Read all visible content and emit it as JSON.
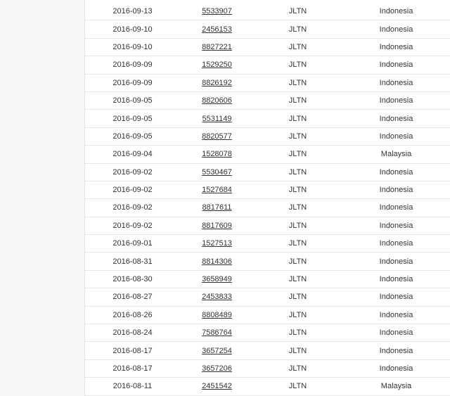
{
  "table": {
    "rows": [
      {
        "date": "2016-09-13",
        "id": "5533907",
        "code": "JLTN",
        "country": "Indonesia"
      },
      {
        "date": "2016-09-10",
        "id": "2456153",
        "code": "JLTN",
        "country": "Indonesia"
      },
      {
        "date": "2016-09-10",
        "id": "8827221",
        "code": "JLTN",
        "country": "Indonesia"
      },
      {
        "date": "2016-09-09",
        "id": "1529250",
        "code": "JLTN",
        "country": "Indonesia"
      },
      {
        "date": "2016-09-09",
        "id": "8826192",
        "code": "JLTN",
        "country": "Indonesia"
      },
      {
        "date": "2016-09-05",
        "id": "8820606",
        "code": "JLTN",
        "country": "Indonesia"
      },
      {
        "date": "2016-09-05",
        "id": "5531149",
        "code": "JLTN",
        "country": "Indonesia"
      },
      {
        "date": "2016-09-05",
        "id": "8820577",
        "code": "JLTN",
        "country": "Indonesia"
      },
      {
        "date": "2016-09-04",
        "id": "1528078",
        "code": "JLTN",
        "country": "Malaysia"
      },
      {
        "date": "2016-09-02",
        "id": "5530467",
        "code": "JLTN",
        "country": "Indonesia"
      },
      {
        "date": "2016-09-02",
        "id": "1527684",
        "code": "JLTN",
        "country": "Indonesia"
      },
      {
        "date": "2016-09-02",
        "id": "8817611",
        "code": "JLTN",
        "country": "Indonesia"
      },
      {
        "date": "2016-09-02",
        "id": "8817609",
        "code": "JLTN",
        "country": "Indonesia"
      },
      {
        "date": "2016-09-01",
        "id": "1527513",
        "code": "JLTN",
        "country": "Indonesia"
      },
      {
        "date": "2016-08-31",
        "id": "8814306",
        "code": "JLTN",
        "country": "Indonesia"
      },
      {
        "date": "2016-08-30",
        "id": "3658949",
        "code": "JLTN",
        "country": "Indonesia"
      },
      {
        "date": "2016-08-27",
        "id": "2453833",
        "code": "JLTN",
        "country": "Indonesia"
      },
      {
        "date": "2016-08-26",
        "id": "8808489",
        "code": "JLTN",
        "country": "Indonesia"
      },
      {
        "date": "2016-08-24",
        "id": "7586764",
        "code": "JLTN",
        "country": "Indonesia"
      },
      {
        "date": "2016-08-17",
        "id": "3657254",
        "code": "JLTN",
        "country": "Indonesia"
      },
      {
        "date": "2016-08-17",
        "id": "3657206",
        "code": "JLTN",
        "country": "Indonesia"
      },
      {
        "date": "2016-08-11",
        "id": "2451542",
        "code": "JLTN",
        "country": "Malaysia"
      }
    ]
  }
}
